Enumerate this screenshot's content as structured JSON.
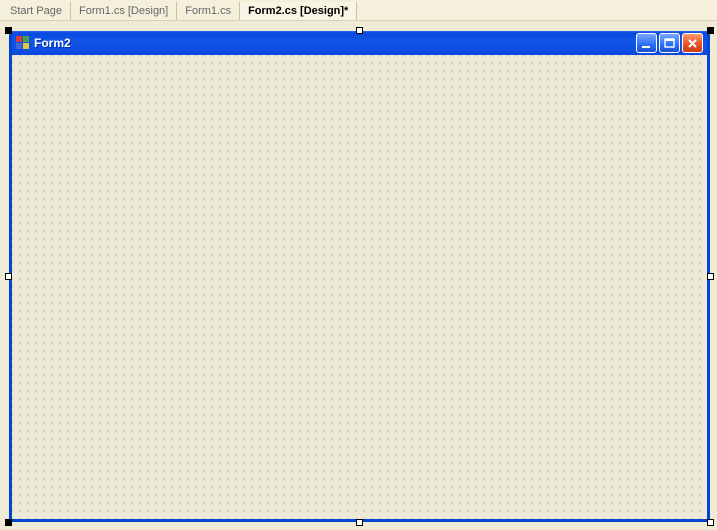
{
  "tabs": [
    {
      "label": "Start Page",
      "active": false
    },
    {
      "label": "Form1.cs [Design]",
      "active": false
    },
    {
      "label": "Form1.cs",
      "active": false
    },
    {
      "label": "Form2.cs [Design]*",
      "active": true
    }
  ],
  "form": {
    "title": "Form2"
  }
}
